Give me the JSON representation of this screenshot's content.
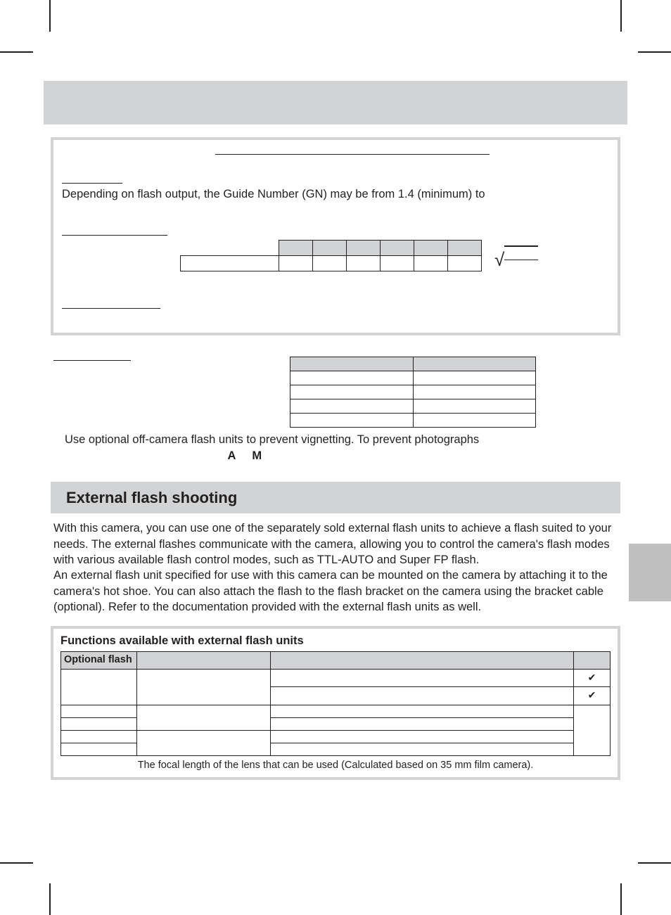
{
  "tips": {
    "body_line1": "Depending on flash output, the Guide Number (GN) may be from 1.4 (minimum) to"
  },
  "cautions": {
    "note_prefix": "Use optional off-camera flash units to prevent vignetting. To prevent photographs",
    "bold_A": "A",
    "bold_M": "M"
  },
  "section": {
    "title": "External flash shooting",
    "para1": "With this camera, you can use one of the separately sold external flash units to achieve a flash suited to your needs. The external flashes communicate with the camera, allowing you to control the camera's flash modes with various available flash control modes, such as TTL-AUTO and Super FP flash.",
    "para2": "An external flash unit specified for use with this camera can be mounted on the camera by attaching it to the camera's hot shoe. You can also attach the flash to the flash bracket on the camera using the bracket cable (optional). Refer to the documentation provided with the external flash units as well."
  },
  "func": {
    "title": "Functions available with external flash units",
    "header_col1": "Optional flash",
    "check": "✔",
    "footnote": "The focal length of the lens that can be used (Calculated based on 35 mm film camera)."
  }
}
